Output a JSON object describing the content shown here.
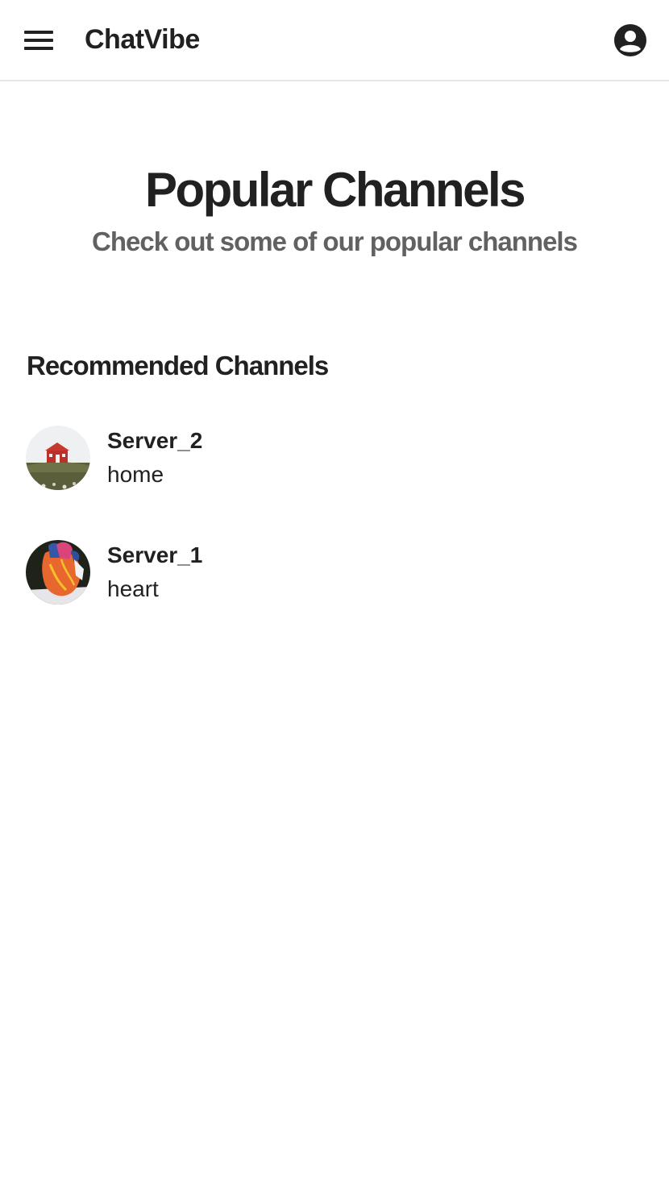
{
  "appbar": {
    "title": "ChatVibe",
    "menu_icon": "hamburger-menu-icon",
    "account_icon": "account-circle-icon"
  },
  "hero": {
    "title": "Popular Channels",
    "subtitle": "Check out some of our popular channels"
  },
  "recommended": {
    "heading": "Recommended Channels",
    "channels": [
      {
        "name": "Server_2",
        "topic": "home",
        "avatar": "red-house-on-hill-thumbnail"
      },
      {
        "name": "Server_1",
        "topic": "heart",
        "avatar": "anatomical-heart-model-thumbnail"
      }
    ]
  },
  "colors": {
    "text_primary": "#212121",
    "text_secondary": "#616161",
    "divider": "#e6e6e6",
    "background": "#ffffff"
  }
}
